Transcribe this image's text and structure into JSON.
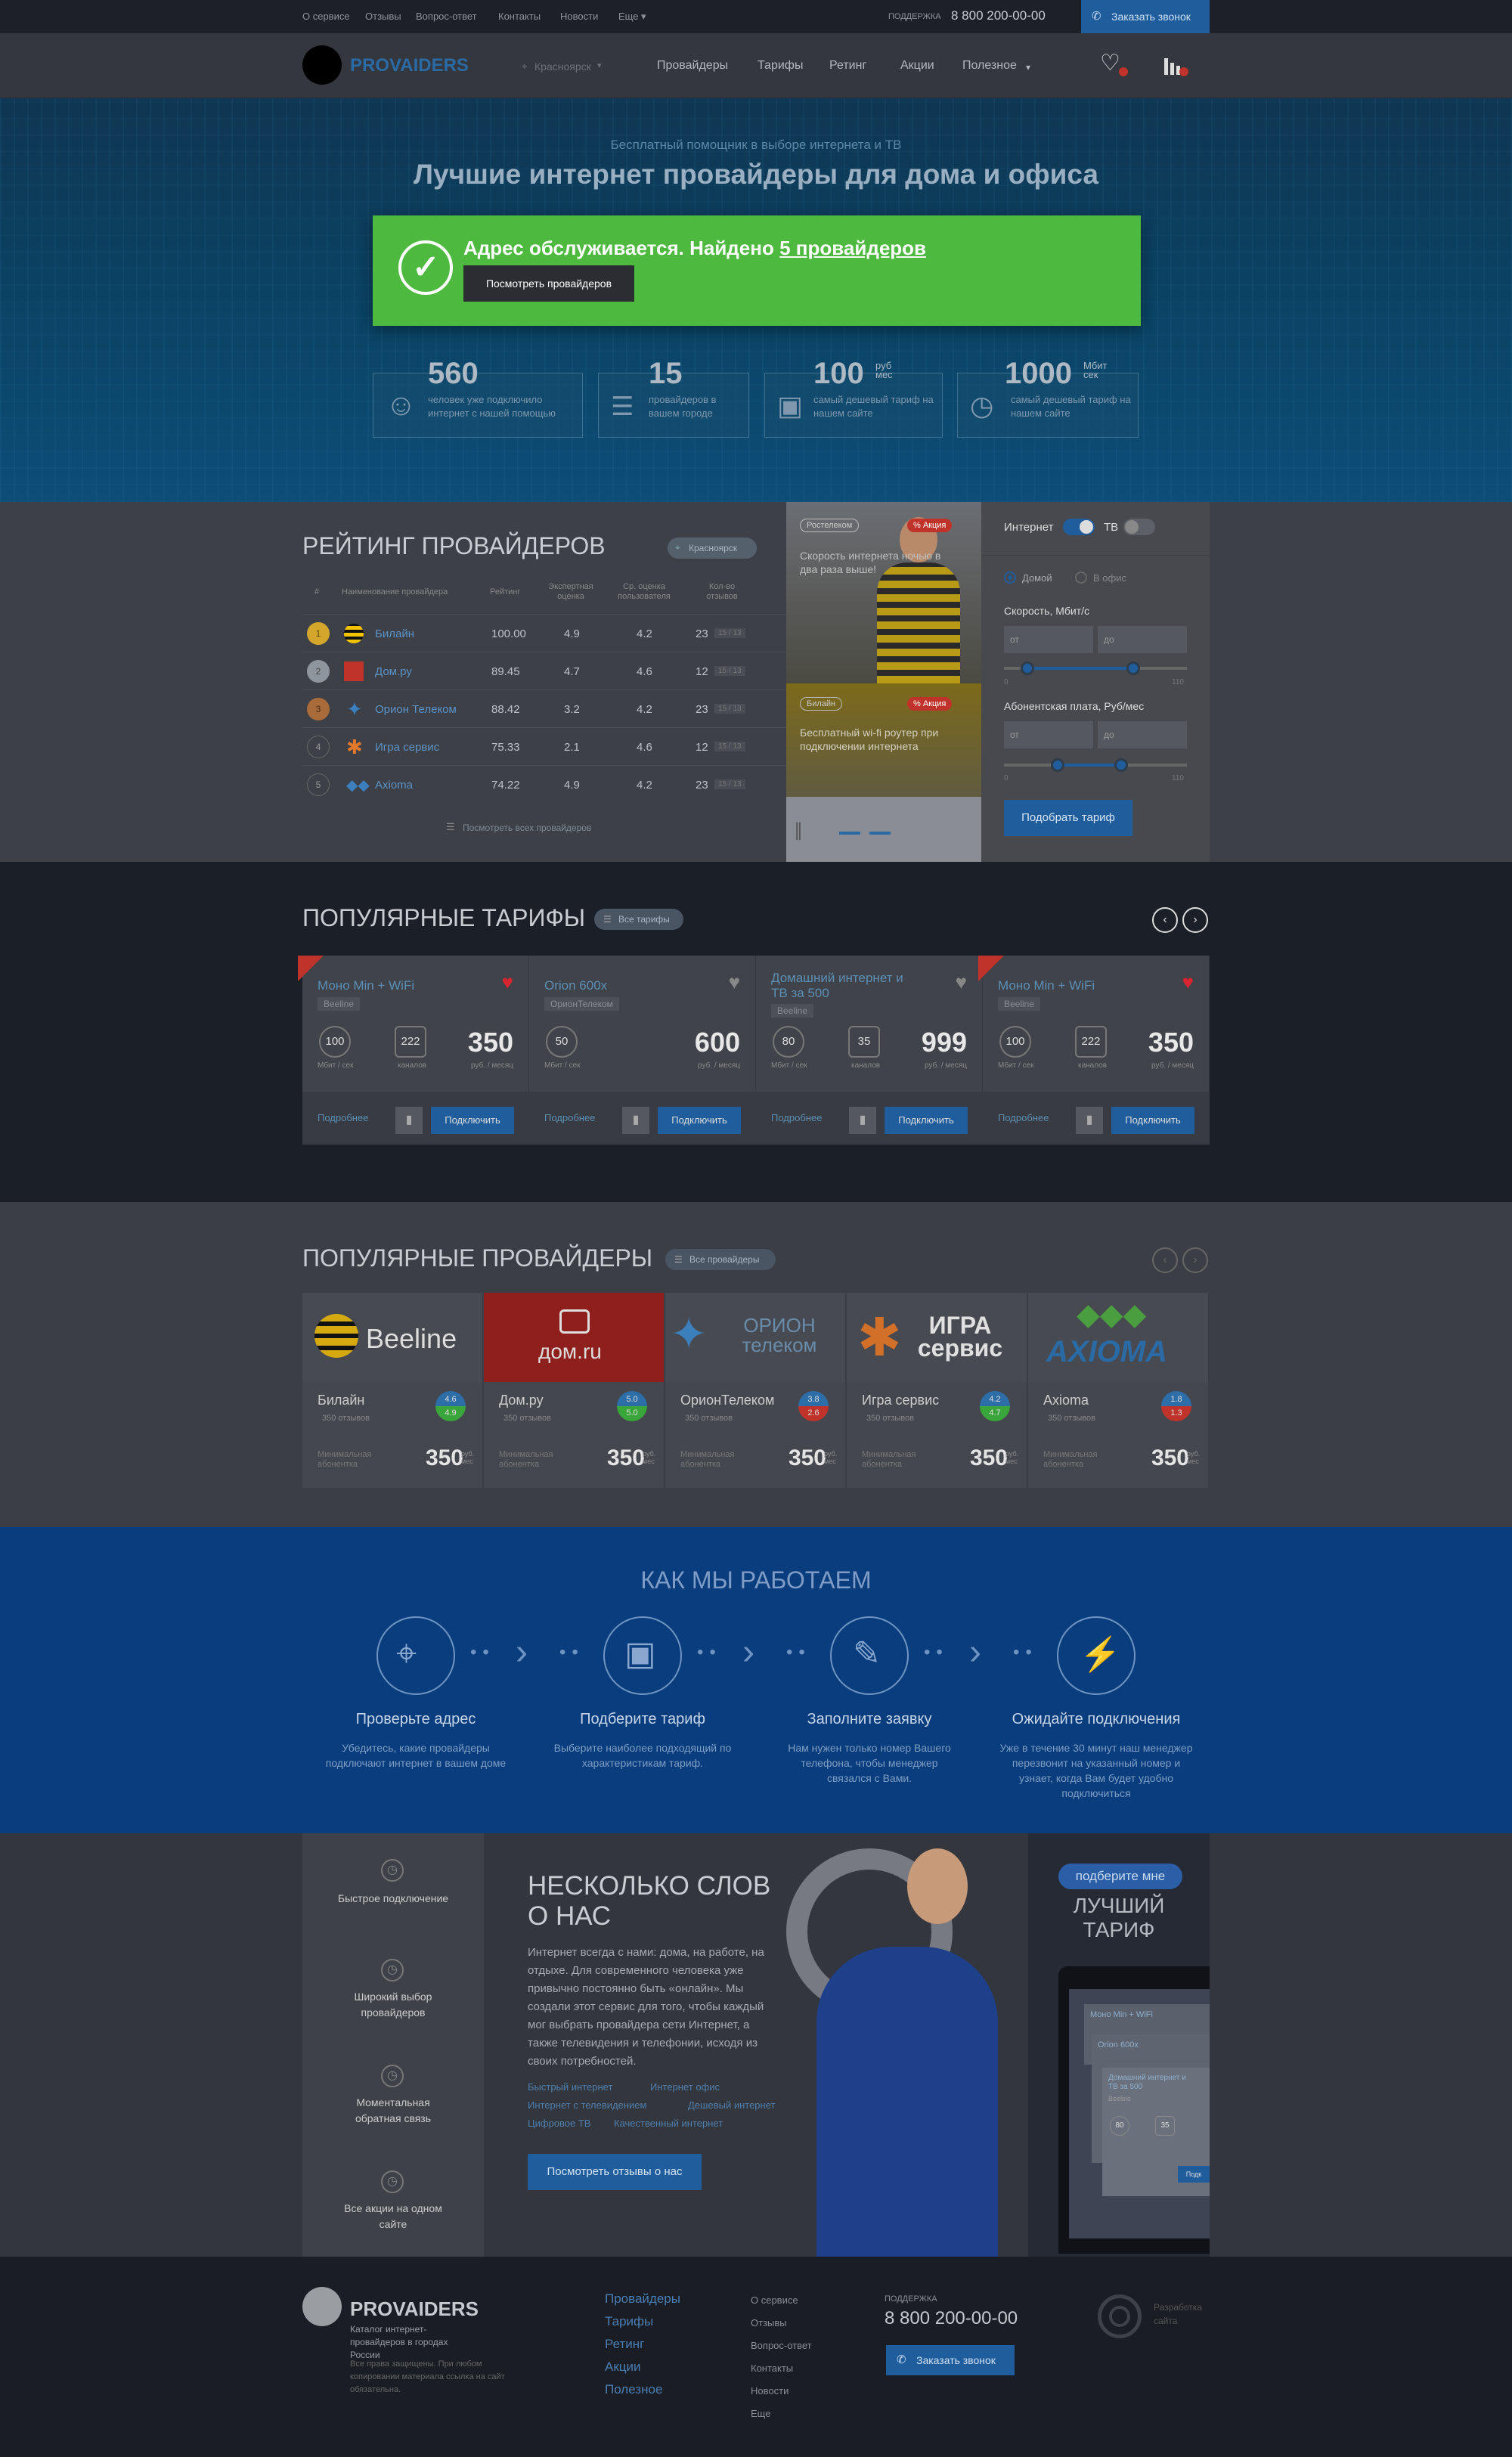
{
  "topbar": {
    "links": [
      "О сервисе",
      "Отзывы",
      "Вопрос-ответ",
      "Контакты",
      "Новости",
      "Еще"
    ],
    "support_label": "ПОДДЕРЖКА",
    "phone": "8 800 200-00-00",
    "callback": "Заказать звонок"
  },
  "nav": {
    "logo": "PROVAIDERS",
    "city": "Красноярск",
    "links": [
      "Провайдеры",
      "Тарифы",
      "Ретинг",
      "Акции",
      "Полезное"
    ]
  },
  "hero": {
    "subtitle": "Бесплатный помощник в выборе интернета и ТВ",
    "title": "Лучшие интернет провайдеры для дома и офиса",
    "found_prefix": "Адрес обслуживается. Найдено ",
    "found_link": "5 провайдеров",
    "show_button": "Посмотреть провайдеров",
    "stats": [
      {
        "big": "560",
        "unit": "",
        "text": "человек уже подключило интернет с нашей помощью"
      },
      {
        "big": "15",
        "unit": "",
        "text": "провайдеров в вашем городе"
      },
      {
        "big": "100",
        "unit": "руб мес",
        "text": "самый дешевый тариф на нашем сайте"
      },
      {
        "big": "1000",
        "unit": "Мбит сек",
        "text": "самый дешевый тариф на нашем сайте"
      }
    ]
  },
  "rating": {
    "title": "РЕЙТИНГ ПРОВАЙДЕРОВ",
    "city": "Красноярск",
    "headers": [
      "#",
      "Наименование провайдера",
      "Рейтинг",
      "Экспертная оценка",
      "Ср. оценка пользователя",
      "Кол-во отзывов"
    ],
    "rows": [
      {
        "n": "1",
        "name": "Билайн",
        "rating": "100.00",
        "expert": "4.9",
        "user": "4.2",
        "reviews": "23",
        "extra": "15 / 13"
      },
      {
        "n": "2",
        "name": "Дом.ру",
        "rating": "89.45",
        "expert": "4.7",
        "user": "4.6",
        "reviews": "12",
        "extra": "15 / 13"
      },
      {
        "n": "3",
        "name": "Орион Телеком",
        "rating": "88.42",
        "expert": "3.2",
        "user": "4.2",
        "reviews": "23",
        "extra": "15 / 13"
      },
      {
        "n": "4",
        "name": "Игра сервис",
        "rating": "75.33",
        "expert": "2.1",
        "user": "4.6",
        "reviews": "12",
        "extra": "15 / 13"
      },
      {
        "n": "5",
        "name": "Axioma",
        "rating": "74.22",
        "expert": "4.9",
        "user": "4.2",
        "reviews": "23",
        "extra": "15 / 13"
      }
    ],
    "all_link": "Посмотреть всех провайдеров"
  },
  "promo": {
    "badge1": "Ростелеком",
    "sale": "% Акция",
    "text1": "Скорость интернета ночью в два раза выше!",
    "badge2": "Билайн",
    "text2": "Бесплатный wi-fi роутер при подключении интернета"
  },
  "filter": {
    "internet": "Интернет",
    "tv": "ТВ",
    "home": "Домой",
    "office": "В офис",
    "speed_label": "Скорость, Мбит/с",
    "fee_label": "Абонентская плата, Руб/мес",
    "from": "от",
    "to": "до",
    "min1": "0",
    "max1": "110",
    "min2": "0",
    "max2": "110",
    "button": "Подобрать тариф"
  },
  "tariffs": {
    "title": "ПОПУЛЯРНЫЕ ТАРИФЫ",
    "all": "Все тарифы",
    "cards": [
      {
        "name": "Моно Min + WiFi",
        "provider": "Beeline",
        "speed": "100",
        "channels": "222",
        "price": "350",
        "fav": true,
        "hit": true
      },
      {
        "name": "Orion 600x",
        "provider": "ОрионТелеком",
        "speed": "50",
        "channels": "",
        "price": "600",
        "fav": false,
        "hit": false
      },
      {
        "name": "Домашний интернет и ТВ за 500",
        "provider": "Beeline",
        "speed": "80",
        "channels": "35",
        "price": "999",
        "fav": false,
        "hit": false
      },
      {
        "name": "Моно Min + WiFi",
        "provider": "Beeline",
        "speed": "100",
        "channels": "222",
        "price": "350",
        "fav": true,
        "hit": true
      }
    ],
    "speed_unit": "Мбит / сек",
    "channels_unit": "каналов",
    "price_unit": "руб. / месяц",
    "more": "Подробнее",
    "connect": "Подключить"
  },
  "providers": {
    "title": "ПОПУЛЯРНЫЕ ПРОВАЙДЕРЫ",
    "all": "Все провайдеры",
    "cards": [
      {
        "name": "Билайн",
        "logo": "Beeline",
        "reviews": "350 отзывов",
        "r1": "4.6",
        "r2": "4.9",
        "c1": "#2d6da8",
        "c2": "#3aa53a",
        "price": "350"
      },
      {
        "name": "Дом.ру",
        "logo": "дом.ru",
        "reviews": "350 отзывов",
        "r1": "5.0",
        "r2": "5.0",
        "c1": "#2d6da8",
        "c2": "#3aa53a",
        "price": "350"
      },
      {
        "name": "ОрионТелеком",
        "logo": "ОРИОН телеком",
        "reviews": "350 отзывов",
        "r1": "3.8",
        "r2": "2.6",
        "c1": "#2d6da8",
        "c2": "#c0332b",
        "price": "350"
      },
      {
        "name": "Игра сервис",
        "logo": "ИГРА сервис",
        "reviews": "350 отзывов",
        "r1": "4.2",
        "r2": "4.7",
        "c1": "#2d6da8",
        "c2": "#3aa53a",
        "price": "350"
      },
      {
        "name": "Axioma",
        "logo": "AXIOMA",
        "reviews": "350 отзывов",
        "r1": "1.8",
        "r2": "1.3",
        "c1": "#2d6da8",
        "c2": "#c0332b",
        "price": "350"
      }
    ],
    "min_label": "Минимальная абонентка",
    "unit": "руб. мес"
  },
  "how": {
    "title": "КАК МЫ РАБОТАЕМ",
    "steps": [
      {
        "t": "Проверьте адрес",
        "d": "Убедитесь, какие провайдеры подключают интернет в вашем доме"
      },
      {
        "t": "Подберите тариф",
        "d": "Выберите наиболее подходящий по характеристикам тариф."
      },
      {
        "t": "Заполните заявку",
        "d": "Нам нужен только номер Вашего телефона, чтобы менеджер связался с Вами."
      },
      {
        "t": "Ожидайте подключения",
        "d": "Уже в течение 30 минут наш менеджер перезвонит на указанный номер и узнает, когда Вам будет удобно подключиться"
      }
    ]
  },
  "about": {
    "features": [
      "Быстрое подключение",
      "Широкий выбор провайдеров",
      "Моментальная обратная связь",
      "Все акции на одном сайте"
    ],
    "title1": "НЕСКОЛЬКО СЛОВ",
    "title2": "О НАС",
    "text": "Интернет всегда с нами: дома, на работе, на отдыхе. Для современного человека уже привычно постоянно быть «онлайн». Мы создали этот сервис для того, чтобы каждый мог выбрать провайдера сети Интернет, а также телевидения и телефонии, исходя из своих потребностей.",
    "tags": [
      "Быстрый интернет",
      "Интернет офис",
      "Интернет с телевидением",
      "Дешевый интернет",
      "Цифровое ТВ",
      "Качественный интернет"
    ],
    "reviews_button": "Посмотреть отзывы о нас",
    "banner_pill": "подберите мне",
    "banner_title1": "ЛУЧШИЙ",
    "banner_title2": "ТАРИФ",
    "mini1": "Моно Min + WiFi",
    "mini2": "Orion 600x",
    "mini3": "Домашний интернет и ТВ за 500",
    "mini_b": "Beeline",
    "mini_80": "80",
    "mini_35": "35",
    "mini_btn": "Подк"
  },
  "footer": {
    "logo": "PROVAIDERS",
    "desc": "Каталог интернет-провайдеров в городах России",
    "copy": "Все права защищены. При любом копировании материала ссылка на сайт обязательна.",
    "col1": [
      "Провайдеры",
      "Тарифы",
      "Ретинг",
      "Акции",
      "Полезное"
    ],
    "col2": [
      "О сервисе",
      "Отзывы",
      "Вопрос-ответ",
      "Контакты",
      "Новости",
      "Еще"
    ],
    "support": "ПОДДЕРЖКА",
    "phone": "8 800 200-00-00",
    "callback": "Заказать звонок",
    "dev": "Разработка сайта"
  }
}
